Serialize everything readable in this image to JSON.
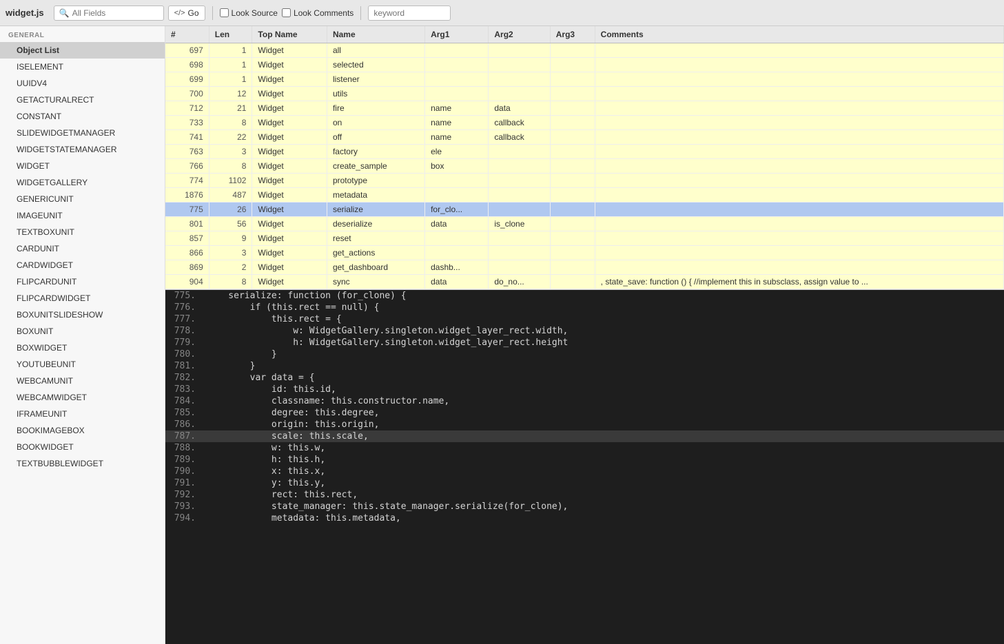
{
  "toolbar": {
    "title": "widget.js",
    "all_fields_label": "All Fields",
    "all_fields_placeholder": "All Fields",
    "go_label": "Go",
    "look_source_label": "Look Source",
    "look_comments_label": "Look Comments",
    "keyword_placeholder": "keyword"
  },
  "sidebar": {
    "section_general": "GENERAL",
    "items": [
      {
        "id": "object-list",
        "label": "Object List",
        "active": true
      },
      {
        "id": "iselement",
        "label": "ISELEMENT"
      },
      {
        "id": "uuidv4",
        "label": "UUIDV4"
      },
      {
        "id": "getacturalrect",
        "label": "GETACTURALRECT"
      },
      {
        "id": "constant",
        "label": "CONSTANT"
      },
      {
        "id": "slidewidgetmanager",
        "label": "SLIDEWIDGETMANAGER"
      },
      {
        "id": "widgetstatemanager",
        "label": "WIDGETSTATEMANAGER"
      },
      {
        "id": "widget",
        "label": "WIDGET"
      },
      {
        "id": "widgetgallery",
        "label": "WIDGETGALLERY"
      },
      {
        "id": "genericunit",
        "label": "GENERICUNIT"
      },
      {
        "id": "imageunit",
        "label": "IMAGEUNIT"
      },
      {
        "id": "textboxunit",
        "label": "TEXTBOXUNIT"
      },
      {
        "id": "cardunit",
        "label": "CARDUNIT"
      },
      {
        "id": "cardwidget",
        "label": "CARDWIDGET"
      },
      {
        "id": "flipcardunit",
        "label": "FLIPCARDUNIT"
      },
      {
        "id": "flipcardwidget",
        "label": "FLIPCARDWIDGET"
      },
      {
        "id": "boxunitslideshow",
        "label": "BOXUNITSLIDESHOW"
      },
      {
        "id": "boxunit",
        "label": "BOXUNIT"
      },
      {
        "id": "boxwidget",
        "label": "BOXWIDGET"
      },
      {
        "id": "youtubeunit",
        "label": "YOUTUBEUNIT"
      },
      {
        "id": "webcamunit",
        "label": "WEBCAMUNIT"
      },
      {
        "id": "webcamwidget",
        "label": "WEBCAMWIDGET"
      },
      {
        "id": "iframeunit",
        "label": "IFRAMEUNIT"
      },
      {
        "id": "bookimagebox",
        "label": "BOOKIMAGEBOX"
      },
      {
        "id": "bookwidget",
        "label": "BOOKWIDGET"
      },
      {
        "id": "textbubblewidget",
        "label": "TEXTBUBBLEWIDGET"
      }
    ]
  },
  "table": {
    "columns": [
      "#",
      "Len",
      "Top Name",
      "Name",
      "Arg1",
      "Arg2",
      "Arg3",
      "Comments"
    ],
    "rows": [
      {
        "num": "697",
        "len": "1",
        "topname": "Widget",
        "name": "all",
        "arg1": "",
        "arg2": "",
        "arg3": "",
        "comments": "",
        "selected": false
      },
      {
        "num": "698",
        "len": "1",
        "topname": "Widget",
        "name": "selected",
        "arg1": "",
        "arg2": "",
        "arg3": "",
        "comments": "",
        "selected": false
      },
      {
        "num": "699",
        "len": "1",
        "topname": "Widget",
        "name": "listener",
        "arg1": "",
        "arg2": "",
        "arg3": "",
        "comments": "",
        "selected": false
      },
      {
        "num": "700",
        "len": "12",
        "topname": "Widget",
        "name": "utils",
        "arg1": "",
        "arg2": "",
        "arg3": "",
        "comments": "",
        "selected": false
      },
      {
        "num": "712",
        "len": "21",
        "topname": "Widget",
        "name": "fire",
        "arg1": "name",
        "arg2": "data",
        "arg3": "",
        "comments": "",
        "selected": false
      },
      {
        "num": "733",
        "len": "8",
        "topname": "Widget",
        "name": "on",
        "arg1": "name",
        "arg2": "callback",
        "arg3": "",
        "comments": "",
        "selected": false
      },
      {
        "num": "741",
        "len": "22",
        "topname": "Widget",
        "name": "off",
        "arg1": "name",
        "arg2": "callback",
        "arg3": "",
        "comments": "",
        "selected": false
      },
      {
        "num": "763",
        "len": "3",
        "topname": "Widget",
        "name": "factory",
        "arg1": "ele",
        "arg2": "",
        "arg3": "",
        "comments": "",
        "selected": false
      },
      {
        "num": "766",
        "len": "8",
        "topname": "Widget",
        "name": "create_sample",
        "arg1": "box",
        "arg2": "",
        "arg3": "",
        "comments": "",
        "selected": false
      },
      {
        "num": "774",
        "len": "1102",
        "topname": "Widget",
        "name": "prototype",
        "arg1": "",
        "arg2": "",
        "arg3": "",
        "comments": "",
        "selected": false
      },
      {
        "num": "1876",
        "len": "487",
        "topname": "Widget",
        "name": "metadata",
        "arg1": "",
        "arg2": "",
        "arg3": "",
        "comments": "",
        "selected": false
      },
      {
        "num": "775",
        "len": "26",
        "topname": "Widget",
        "name": "serialize",
        "arg1": "for_clo...",
        "arg2": "",
        "arg3": "",
        "comments": "",
        "selected": true
      },
      {
        "num": "801",
        "len": "56",
        "topname": "Widget",
        "name": "deserialize",
        "arg1": "data",
        "arg2": "is_clone",
        "arg3": "",
        "comments": "",
        "selected": false
      },
      {
        "num": "857",
        "len": "9",
        "topname": "Widget",
        "name": "reset",
        "arg1": "",
        "arg2": "",
        "arg3": "",
        "comments": "",
        "selected": false
      },
      {
        "num": "866",
        "len": "3",
        "topname": "Widget",
        "name": "get_actions",
        "arg1": "",
        "arg2": "",
        "arg3": "",
        "comments": "",
        "selected": false
      },
      {
        "num": "869",
        "len": "2",
        "topname": "Widget",
        "name": "get_dashboard",
        "arg1": "dashb...",
        "arg2": "",
        "arg3": "",
        "comments": "",
        "selected": false
      },
      {
        "num": "904",
        "len": "8",
        "topname": "Widget",
        "name": "sync",
        "arg1": "data",
        "arg2": "do_no...",
        "arg3": "",
        "comments": ", state_save: function () { //implement this in subsclass, assign value to ...",
        "selected": false
      }
    ]
  },
  "code": {
    "lines": [
      {
        "num": "775.",
        "text": "    serialize: function (for_clone) {",
        "highlighted": false
      },
      {
        "num": "776.",
        "text": "        if (this.rect == null) {",
        "highlighted": false
      },
      {
        "num": "777.",
        "text": "            this.rect = {",
        "highlighted": false
      },
      {
        "num": "778.",
        "text": "                w: WidgetGallery.singleton.widget_layer_rect.width,",
        "highlighted": false
      },
      {
        "num": "779.",
        "text": "                h: WidgetGallery.singleton.widget_layer_rect.height",
        "highlighted": false
      },
      {
        "num": "780.",
        "text": "            }",
        "highlighted": false
      },
      {
        "num": "781.",
        "text": "        }",
        "highlighted": false
      },
      {
        "num": "782.",
        "text": "        var data = {",
        "highlighted": false
      },
      {
        "num": "783.",
        "text": "            id: this.id,",
        "highlighted": false
      },
      {
        "num": "784.",
        "text": "            classname: this.constructor.name,",
        "highlighted": false
      },
      {
        "num": "785.",
        "text": "            degree: this.degree,",
        "highlighted": false
      },
      {
        "num": "786.",
        "text": "            origin: this.origin,",
        "highlighted": false
      },
      {
        "num": "787.",
        "text": "            scale: this.scale,",
        "highlighted": true
      },
      {
        "num": "788.",
        "text": "            w: this.w,",
        "highlighted": false
      },
      {
        "num": "789.",
        "text": "            h: this.h,",
        "highlighted": false
      },
      {
        "num": "790.",
        "text": "            x: this.x,",
        "highlighted": false
      },
      {
        "num": "791.",
        "text": "            y: this.y,",
        "highlighted": false
      },
      {
        "num": "792.",
        "text": "            rect: this.rect,",
        "highlighted": false
      },
      {
        "num": "793.",
        "text": "            state_manager: this.state_manager.serialize(for_clone),",
        "highlighted": false
      },
      {
        "num": "794.",
        "text": "            metadata: this.metadata,",
        "highlighted": false
      }
    ]
  }
}
